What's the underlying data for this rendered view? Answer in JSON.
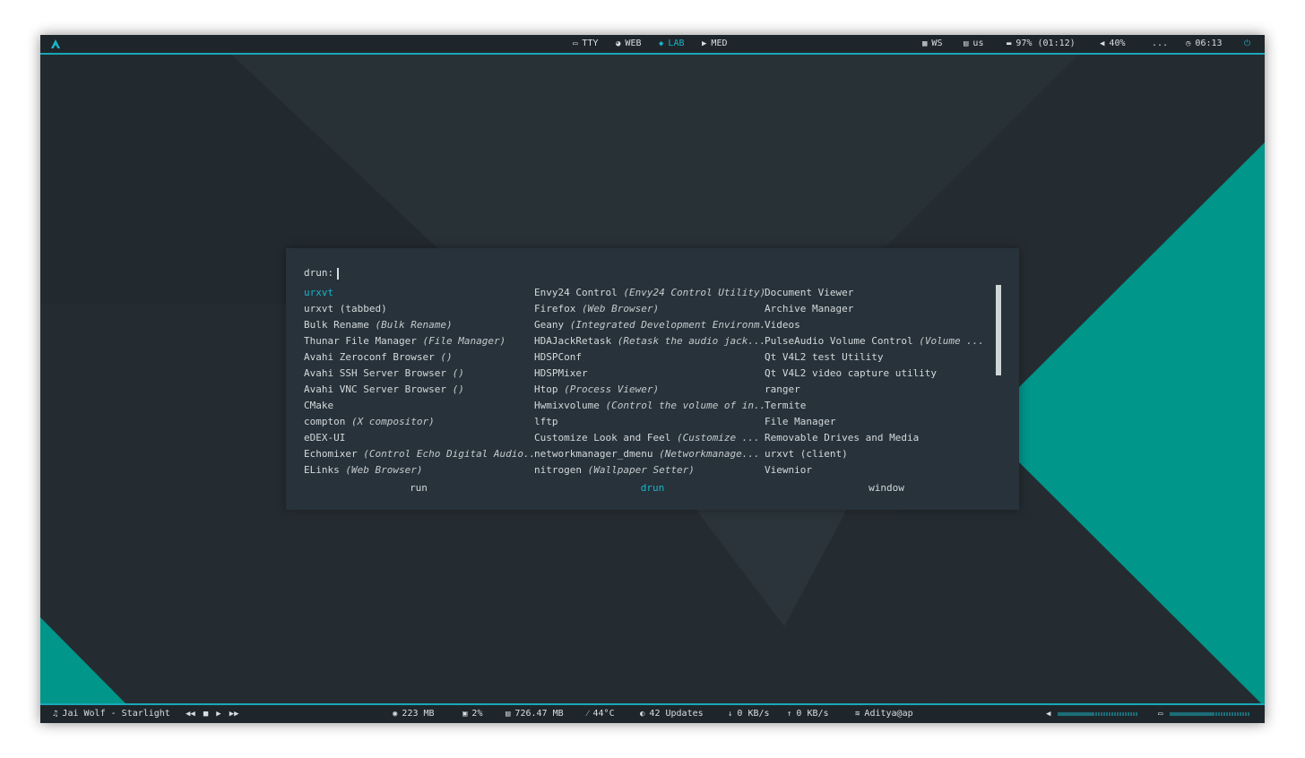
{
  "colors": {
    "accent": "#1bb4c9",
    "teal": "#00968a",
    "bar_bg": "#1f262b",
    "launcher_bg": "#27323a"
  },
  "topbar": {
    "launcher_icon": "arch-logo-icon",
    "workspaces": [
      {
        "icon": "terminal-icon",
        "label": "TTY",
        "active": false
      },
      {
        "icon": "compass-icon",
        "label": "WEB",
        "active": false
      },
      {
        "icon": "cat-icon",
        "label": "LAB",
        "active": true
      },
      {
        "icon": "play-icon",
        "label": "MED",
        "active": false
      }
    ],
    "layout": {
      "icon": "grid-icon",
      "label": "WS"
    },
    "keyboard": {
      "icon": "keyboard-icon",
      "label": "us"
    },
    "battery": {
      "icon": "battery-icon",
      "label": "97% (01:12)"
    },
    "volume": {
      "icon": "speaker-icon",
      "label": "40%"
    },
    "network": {
      "icon": "wifi-icon",
      "label": "..."
    },
    "clock": {
      "icon": "clock-icon",
      "label": "06:13"
    },
    "power_icon": "power-icon"
  },
  "launcher": {
    "prompt": "drun:",
    "columns": [
      [
        {
          "name": "urxvt",
          "desc": "",
          "selected": true
        },
        {
          "name": "urxvt (tabbed)",
          "desc": ""
        },
        {
          "name": "Bulk Rename",
          "desc": "(Bulk Rename)"
        },
        {
          "name": "Thunar File Manager",
          "desc": "(File Manager)"
        },
        {
          "name": "Avahi Zeroconf Browser",
          "desc": "()"
        },
        {
          "name": "Avahi SSH Server Browser",
          "desc": "()"
        },
        {
          "name": "Avahi VNC Server Browser",
          "desc": "()"
        },
        {
          "name": "CMake",
          "desc": ""
        },
        {
          "name": "compton",
          "desc": "(X compositor)"
        },
        {
          "name": "eDEX-UI",
          "desc": ""
        },
        {
          "name": "Echomixer",
          "desc": "(Control Echo Digital Audio..."
        },
        {
          "name": "ELinks",
          "desc": "(Web Browser)"
        }
      ],
      [
        {
          "name": "Envy24 Control",
          "desc": "(Envy24 Control Utility)"
        },
        {
          "name": "Firefox",
          "desc": "(Web Browser)"
        },
        {
          "name": "Geany",
          "desc": "(Integrated Development Environm..."
        },
        {
          "name": "HDAJackRetask",
          "desc": "(Retask the audio jack..."
        },
        {
          "name": "HDSPConf",
          "desc": ""
        },
        {
          "name": "HDSPMixer",
          "desc": ""
        },
        {
          "name": "Htop",
          "desc": "(Process Viewer)"
        },
        {
          "name": "Hwmixvolume",
          "desc": "(Control the volume of in..."
        },
        {
          "name": "lftp",
          "desc": ""
        },
        {
          "name": "Customize Look and Feel",
          "desc": "(Customize ..."
        },
        {
          "name": "networkmanager_dmenu",
          "desc": "(Networkmanage..."
        },
        {
          "name": "nitrogen",
          "desc": "(Wallpaper Setter)"
        }
      ],
      [
        {
          "name": "Document Viewer",
          "desc": ""
        },
        {
          "name": "Archive Manager",
          "desc": ""
        },
        {
          "name": "Videos",
          "desc": ""
        },
        {
          "name": "PulseAudio Volume Control",
          "desc": "(Volume ..."
        },
        {
          "name": "Qt V4L2 test Utility",
          "desc": ""
        },
        {
          "name": "Qt V4L2 video capture utility",
          "desc": ""
        },
        {
          "name": "ranger",
          "desc": ""
        },
        {
          "name": "Termite",
          "desc": ""
        },
        {
          "name": "File Manager",
          "desc": ""
        },
        {
          "name": "Removable Drives and Media",
          "desc": ""
        },
        {
          "name": "urxvt (client)",
          "desc": ""
        },
        {
          "name": "Viewnior",
          "desc": ""
        }
      ]
    ],
    "modes": [
      {
        "label": "run",
        "active": false
      },
      {
        "label": "drun",
        "active": true
      },
      {
        "label": "window",
        "active": false
      }
    ]
  },
  "bottombar": {
    "music": {
      "icon": "music-note-icon",
      "label": "Jai Wolf - Starlight"
    },
    "media_controls": [
      "previous-icon",
      "stop-icon",
      "play-icon",
      "next-icon"
    ],
    "memory": {
      "icon": "memory-icon",
      "label": "223 MB"
    },
    "cpu": {
      "icon": "cpu-icon",
      "label": "2%"
    },
    "disk": {
      "icon": "disk-icon",
      "label": "726.47 MB"
    },
    "temperature": {
      "icon": "thermometer-icon",
      "label": "44°C"
    },
    "updates": {
      "icon": "update-icon",
      "label": "42 Updates"
    },
    "download": {
      "icon": "arrow-down-icon",
      "label": "0 KB/s"
    },
    "upload": {
      "icon": "arrow-up-icon",
      "label": "0 KB/s"
    },
    "wifi": {
      "icon": "wifi-icon",
      "label": "Aditya@ap"
    },
    "volume_level": 0.45,
    "brightness_level": 0.55
  }
}
